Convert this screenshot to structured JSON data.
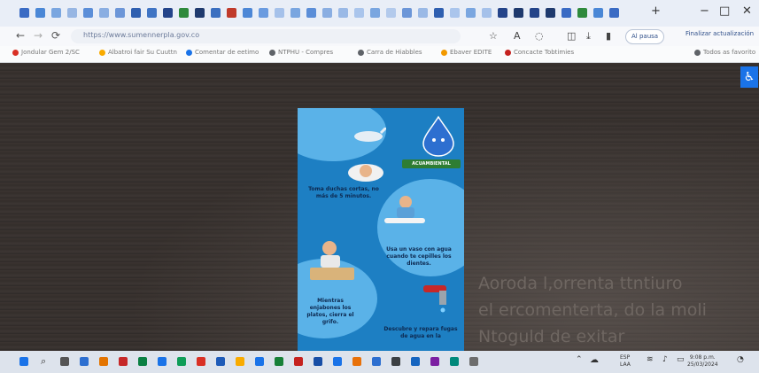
{
  "browser": {
    "url": "https://www.sumennerpla.gov.co",
    "profile_button": "Al pausa",
    "update_button": "Finalizar actualización",
    "win_minimize": "−",
    "win_maximize": "□",
    "win_close": "✕"
  },
  "bookmarks": [
    {
      "label": "Jondular Gem 2/SC",
      "color": "#d93025"
    },
    {
      "label": "Albatroi fair Su Cuuttn",
      "color": "#f9ab00"
    },
    {
      "label": "Comentar de eetimo",
      "color": "#1a73e8"
    },
    {
      "label": "NTPHU - Compres",
      "color": "#5f6368"
    },
    {
      "label": "Carra de Hiabbles",
      "color": "#5f6368"
    },
    {
      "label": "Ebaver EDITE",
      "color": "#f29900"
    },
    {
      "label": "Concacte Tobtimies",
      "color": "#c5221f"
    },
    {
      "label": "Todos as favorito",
      "color": "#5f6368"
    }
  ],
  "background_text": [
    "Aoroda l,orrenta  ttntiuro",
    "el ercomenterta, do la moli",
    "Ntoguld de exitar"
  ],
  "poster": {
    "caption1": "Toma duchas cortas, no más de 5 minutos.",
    "caption2": "Usa un vaso con agua cuando te cepilles los dientes.",
    "caption3": "Mientras enjabones los platos, cierra el grifo.",
    "caption4": "Descubre y repara fugas de agua en la",
    "logo_text": "ACUAMBIENTAL"
  },
  "taskbar": {
    "language": "ESP\nLAA",
    "clock": "9:08 p.m.\n25/03/2024"
  }
}
